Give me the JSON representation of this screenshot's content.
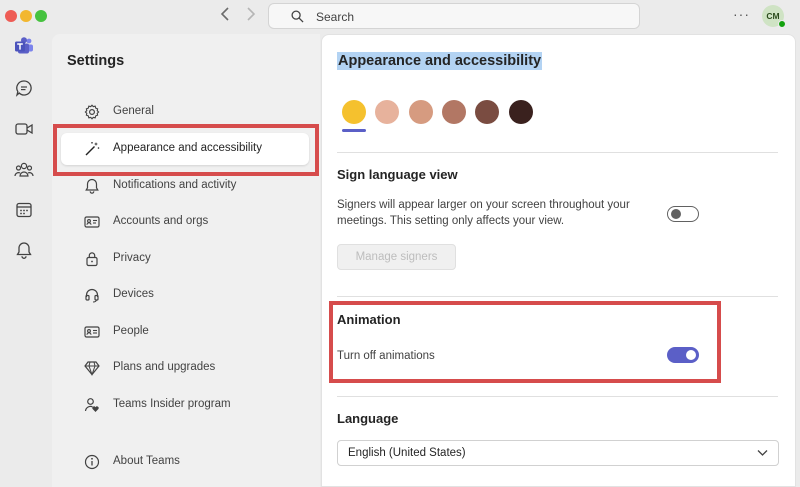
{
  "top_bar": {
    "search_placeholder": "Search",
    "more_label": "···",
    "avatar_initials": "CM"
  },
  "rail": {
    "items": [
      "teams-logo",
      "chat",
      "meet",
      "communities",
      "calendar",
      "activity"
    ]
  },
  "settings": {
    "title": "Settings",
    "nav": [
      {
        "label": "General",
        "icon": "gear-icon"
      },
      {
        "label": "Appearance and accessibility",
        "icon": "magic-wand-icon",
        "active": true
      },
      {
        "label": "Notifications and activity",
        "icon": "bell-icon"
      },
      {
        "label": "Accounts and orgs",
        "icon": "id-card-icon"
      },
      {
        "label": "Privacy",
        "icon": "lock-icon"
      },
      {
        "label": "Devices",
        "icon": "headset-icon"
      },
      {
        "label": "People",
        "icon": "contact-card-icon"
      },
      {
        "label": "Plans and upgrades",
        "icon": "diamond-icon"
      },
      {
        "label": "Teams Insider program",
        "icon": "person-heart-icon"
      },
      {
        "label": "About Teams",
        "icon": "info-icon"
      }
    ]
  },
  "main": {
    "title": "Appearance and accessibility",
    "skin_tones": [
      "#f5c12e",
      "#e7b29c",
      "#d69b80",
      "#b27764",
      "#7a4c41",
      "#3a211e"
    ],
    "selected_skin_tone": 0,
    "sign_language": {
      "heading": "Sign language view",
      "description_line1": "Signers will appear larger on your screen throughout your",
      "description_line2": "meetings. This setting only affects your view.",
      "toggle_on": false,
      "manage_button": "Manage signers"
    },
    "animation": {
      "heading": "Animation",
      "toggle_label": "Turn off animations",
      "toggle_on": true
    },
    "language": {
      "heading": "Language",
      "selected": "English (United States)"
    }
  },
  "colors": {
    "accent": "#5b5fc7",
    "highlight_red": "#d64c4c",
    "title_selection": "#b3d3f3"
  }
}
